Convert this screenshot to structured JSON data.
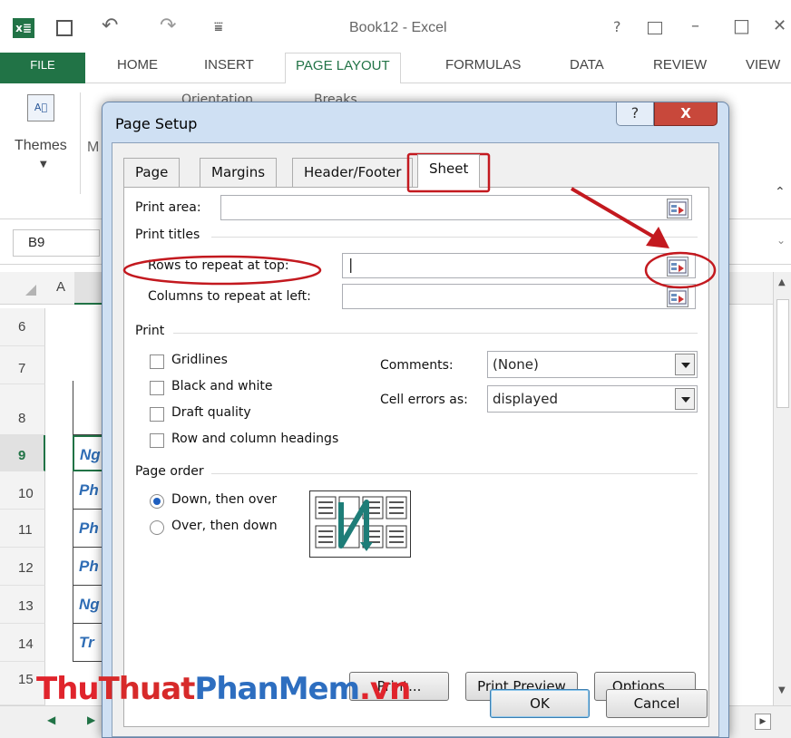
{
  "excel": {
    "window_title": "Book12 - Excel",
    "qat_icons": [
      "excel-logo-icon",
      "save-icon",
      "undo-icon",
      "redo-icon",
      "customize-icon"
    ],
    "title_buttons": [
      "?",
      "ribbon-display-icon",
      "–",
      "□",
      "✕"
    ],
    "tabs": [
      "FILE",
      "HOME",
      "INSERT",
      "PAGE LAYOUT",
      "FORMULAS",
      "DATA",
      "REVIEW",
      "VIEW"
    ],
    "active_tab": "PAGE LAYOUT",
    "ribbon": {
      "themes_label": "Themes",
      "orientation_label": "Orientation",
      "breaks_label": "Breaks"
    },
    "name_box": "B9",
    "column_a": "A",
    "rows": [
      "6",
      "7",
      "8",
      "9",
      "10",
      "11",
      "12",
      "13",
      "14",
      "15"
    ],
    "selected_row": "9",
    "cell_fragments": [
      "Ng",
      "Ph",
      "Ph",
      "Ph",
      "Ng",
      "Tr"
    ],
    "accent_color": "#217346"
  },
  "dialog": {
    "title": "Page Setup",
    "help": "?",
    "close": "X",
    "tabs": [
      "Page",
      "Margins",
      "Header/Footer",
      "Sheet"
    ],
    "active_tab": "Sheet",
    "print_area_label": "Print area:",
    "print_area_value": "",
    "print_titles_label": "Print titles",
    "rows_repeat_label": "Rows to repeat at top:",
    "rows_repeat_value": "|",
    "cols_repeat_label": "Columns to repeat at left:",
    "cols_repeat_value": "",
    "print_section_label": "Print",
    "checkboxes": {
      "gridlines": "Gridlines",
      "black_white": "Black and white",
      "draft": "Draft quality",
      "headings": "Row and column headings"
    },
    "comments_label": "Comments:",
    "comments_value": "(None)",
    "cell_errors_label": "Cell errors as:",
    "cell_errors_value": "displayed",
    "page_order_label": "Page order",
    "radio_down": "Down, then over",
    "radio_over": "Over, then down",
    "selected_order": "Down, then over",
    "buttons": {
      "print": "Print...",
      "preview": "Print Preview",
      "options": "Options...",
      "ok": "OK",
      "cancel": "Cancel"
    }
  },
  "annotation_colors": {
    "arrow": "#c3191f",
    "ellipse": "#c3191f"
  },
  "watermark": {
    "part1": "Thu",
    "part2": "Thuat",
    "part3": "PhanMem",
    "part4": ".vn"
  }
}
